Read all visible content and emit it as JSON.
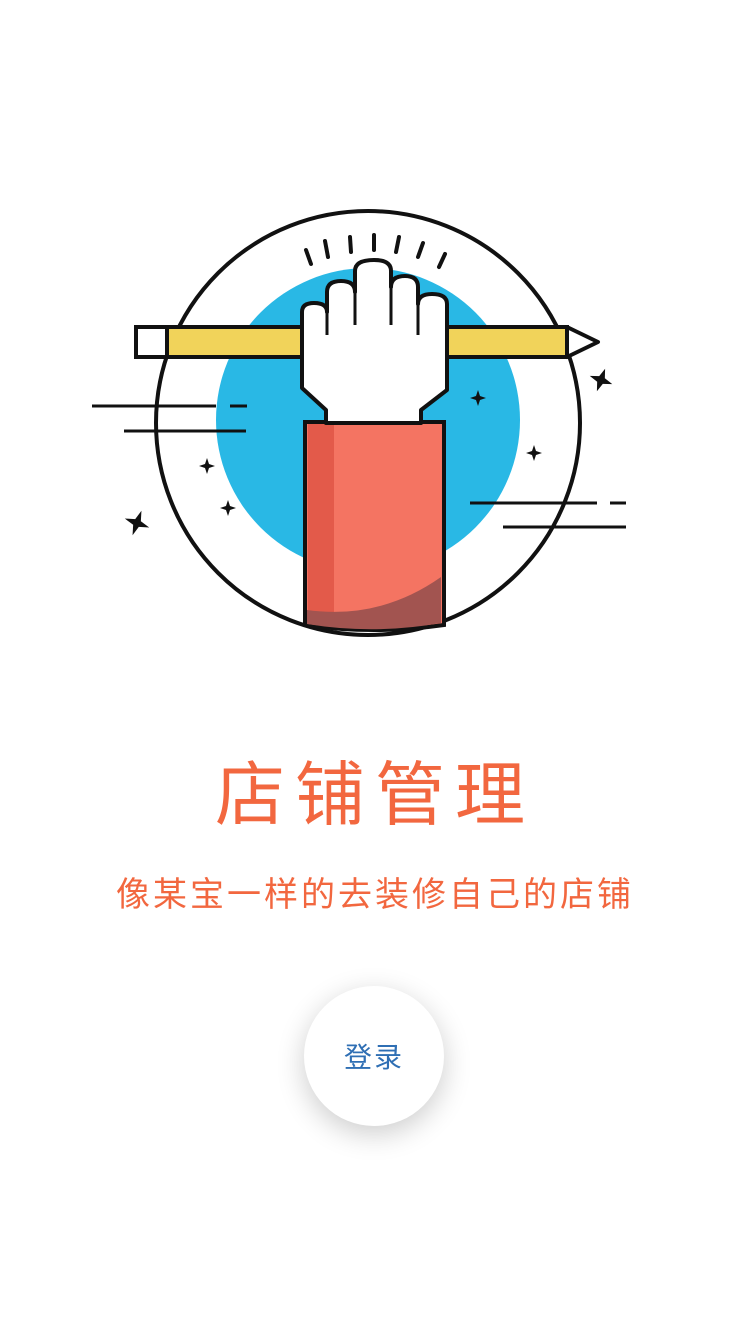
{
  "colors": {
    "accent": "#f2673f",
    "button_text": "#2f6fb4",
    "circle_blue": "#29b8e5",
    "sleeve": "#f47462",
    "sleeve_dark": "#e35a4a",
    "pencil": "#f1d35a"
  },
  "intro": {
    "title": "店铺管理",
    "subtitle": "像某宝一样的去装修自己的店铺"
  },
  "login": {
    "label": "登录"
  },
  "illustration": {
    "icons": [
      "hand-holding-pencil-icon",
      "sparkle-icon",
      "speed-lines-icon"
    ]
  }
}
